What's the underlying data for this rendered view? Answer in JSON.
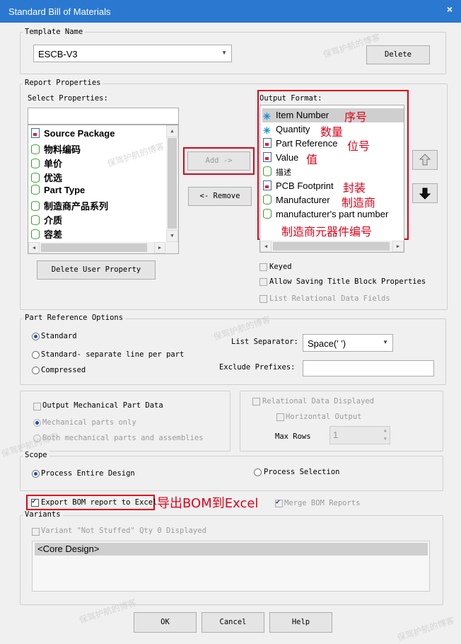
{
  "window": {
    "title": "Standard Bill of Materials",
    "close_glyph": "×"
  },
  "template": {
    "group_label": "Template Name",
    "value": "ESCB-V3",
    "delete_label": "Delete"
  },
  "report": {
    "group_label": "Report Properties",
    "select_label": "Select Properties:",
    "select_items": [
      {
        "label": "Source Package",
        "icon": "document-icon"
      },
      {
        "label": "物料编码",
        "icon": "database-icon"
      },
      {
        "label": "单价",
        "icon": "database-icon"
      },
      {
        "label": "优选",
        "icon": "database-icon"
      },
      {
        "label": "Part Type",
        "icon": "database-icon"
      },
      {
        "label": "制造商产品系列",
        "icon": "database-icon"
      },
      {
        "label": "介质",
        "icon": "database-icon"
      },
      {
        "label": "容差",
        "icon": "database-icon"
      }
    ],
    "add_label": "Add ->",
    "remove_label": "<- Remove",
    "delete_user_label": "Delete User Property",
    "output_label": "Output Format:",
    "output_items": [
      {
        "label": "Item Number",
        "icon": "asterisk-icon"
      },
      {
        "label": "Quantity",
        "icon": "asterisk-icon"
      },
      {
        "label": "Part Reference",
        "icon": "document-icon"
      },
      {
        "label": "Value",
        "icon": "document-icon"
      },
      {
        "label": "描述",
        "icon": "database-icon"
      },
      {
        "label": "PCB Footprint",
        "icon": "document-icon"
      },
      {
        "label": "Manufacturer",
        "icon": "database-icon"
      },
      {
        "label": "manufacturer's part number",
        "icon": "database-icon"
      }
    ],
    "keyed_label": "Keyed",
    "allow_title_label": "Allow Saving Title Block Properties",
    "list_relational_label": "List Relational Data Fields"
  },
  "annotations": {
    "item_number": "序号",
    "quantity": "数量",
    "part_reference": "位号",
    "value": "值",
    "pcb_footprint": "封装",
    "manufacturer": "制造商",
    "mpn": "制造商元器件编号",
    "export": "导出BOM到Excel"
  },
  "part_ref": {
    "group_label": "Part Reference Options",
    "standard": "Standard",
    "separate": "Standard- separate line per part",
    "compressed": "Compressed",
    "separator_label": "List Separator:",
    "separator_value": "Space(' ')",
    "exclude_label": "Exclude Prefixes:",
    "exclude_value": ""
  },
  "mechanical": {
    "output_label": "Output Mechanical Part Data",
    "only_label": "Mechanical parts only",
    "both_label": "Both mechanical parts and assemblies"
  },
  "relational": {
    "displayed_label": "Relational Data Displayed",
    "horizontal_label": "Horizontal Output",
    "max_rows_label": "Max Rows",
    "max_rows_value": "1"
  },
  "scope": {
    "group_label": "Scope",
    "entire": "Process Entire Design",
    "selection": "Process Selection"
  },
  "export": {
    "label": "Export BOM report to Excel",
    "merge_label": "Merge BOM Reports"
  },
  "variants": {
    "group_label": "Variants",
    "not_stuffed_label": "Variant \"Not Stuffed\" Qty 0 Displayed",
    "items": [
      "<Core Design>"
    ]
  },
  "footer": {
    "ok": "OK",
    "cancel": "Cancel",
    "help": "Help"
  },
  "watermark": "保驾护航的博客"
}
